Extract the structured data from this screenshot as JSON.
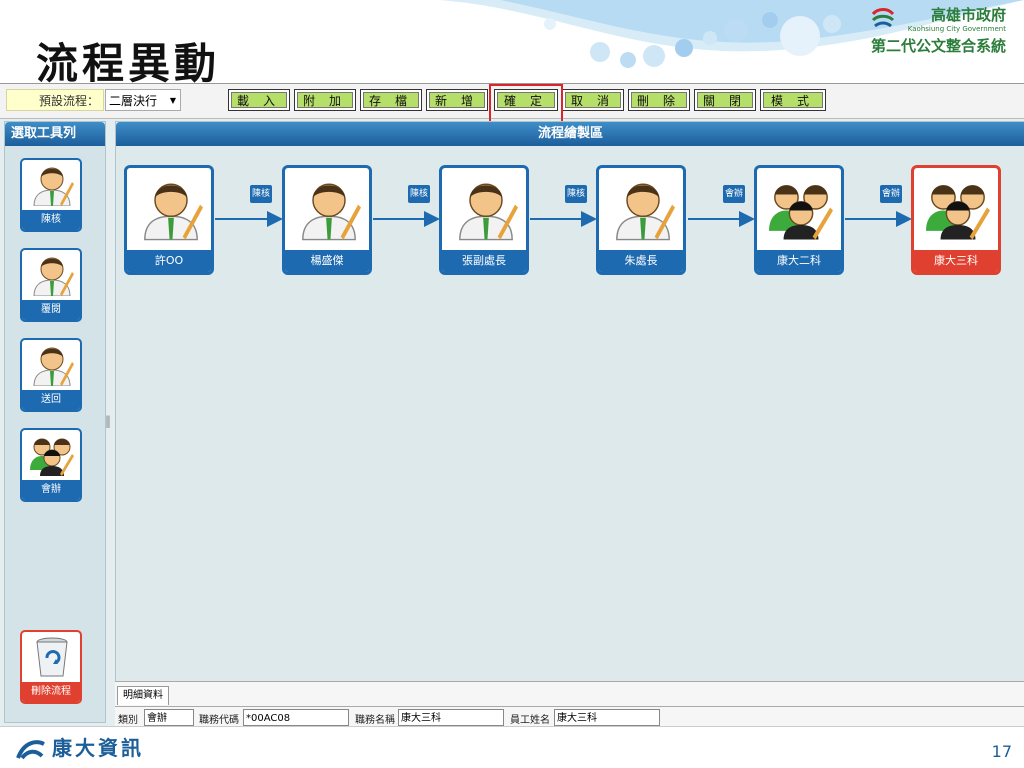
{
  "slide": {
    "title": "流程異動",
    "page_number": "17"
  },
  "header_logo": {
    "line1": "高雄市政府",
    "line2": "Kaohsiung City Government",
    "line3": "第二代公文整合系統"
  },
  "footer": {
    "company": "康大資訊"
  },
  "toolbar": {
    "preset_label": "預設流程：",
    "preset_value": "二層決行",
    "buttons": [
      "載入",
      "附加",
      "存檔",
      "新增",
      "確定",
      "取消",
      "刪除",
      "關閉",
      "模式"
    ],
    "highlighted": "確定"
  },
  "tool_panel": {
    "title": "選取工具列",
    "tools": [
      {
        "label": "陳核",
        "icon": "single-person-icon"
      },
      {
        "label": "覆閱",
        "icon": "single-person-icon"
      },
      {
        "label": "送回",
        "icon": "single-person-icon"
      },
      {
        "label": "會辦",
        "icon": "group-icon"
      }
    ],
    "delete_label": "刪除流程"
  },
  "canvas": {
    "title": "流程繪製區",
    "nodes": [
      {
        "label": "許OO",
        "icon": "single-person-icon",
        "accent": "#1d6ab1"
      },
      {
        "label": "楊盛傑",
        "icon": "single-person-icon",
        "accent": "#1d6ab1"
      },
      {
        "label": "張副處長",
        "icon": "single-person-icon",
        "accent": "#1d6ab1"
      },
      {
        "label": "朱處長",
        "icon": "single-person-icon",
        "accent": "#1d6ab1"
      },
      {
        "label": "康大二科",
        "icon": "group-icon",
        "accent": "#1d6ab1"
      },
      {
        "label": "康大三科",
        "icon": "group-icon",
        "accent": "#e04030"
      }
    ],
    "edges": [
      "陳核",
      "陳核",
      "陳核",
      "會辦",
      "會辦"
    ]
  },
  "detail": {
    "tab": "明細資料",
    "fields": [
      {
        "label": "類別",
        "value": "會辦"
      },
      {
        "label": "職務代碼",
        "value": "*00AC08"
      },
      {
        "label": "職務名稱",
        "value": "康大三科"
      },
      {
        "label": "員工姓名",
        "value": "康大三科"
      }
    ]
  }
}
